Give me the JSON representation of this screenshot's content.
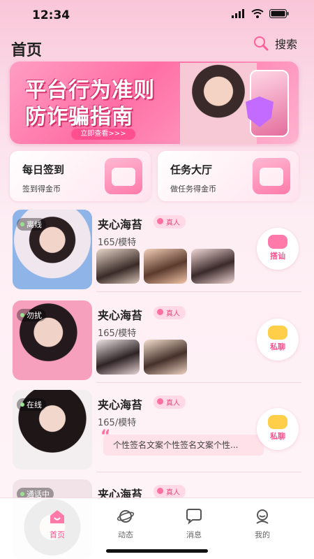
{
  "status": {
    "time": "12:34"
  },
  "header": {
    "title": "首页",
    "search_label": "搜索"
  },
  "banner": {
    "line1": "平台行为准则",
    "line2": "防诈骗指南",
    "cta": "立即查看>>>"
  },
  "cards": [
    {
      "title": "每日签到",
      "sub": "签到得金币",
      "icon": "calendar-check-icon"
    },
    {
      "title": "任务大厅",
      "sub": "做任务得金币",
      "icon": "task-list-icon"
    }
  ],
  "users": [
    {
      "status": "离线",
      "name": "夹心海苔",
      "badge": "真人",
      "meta": "165/模特",
      "action": "搭讪",
      "photos": 3
    },
    {
      "status": "勿扰",
      "name": "夹心海苔",
      "badge": "真人",
      "meta": "165/模特",
      "action": "私聊",
      "photos": 2
    },
    {
      "status": "在线",
      "name": "夹心海苔",
      "badge": "真人",
      "meta": "165/模特",
      "action": "私聊",
      "signature": "个性签名文案个性签名文案个性..."
    },
    {
      "status": "通话中",
      "name": "夹心海苔",
      "badge": "真人"
    }
  ],
  "tabs": [
    {
      "label": "首页",
      "icon": "home-icon",
      "active": true
    },
    {
      "label": "动态",
      "icon": "planet-icon"
    },
    {
      "label": "消息",
      "icon": "message-icon"
    },
    {
      "label": "我的",
      "icon": "profile-icon"
    }
  ],
  "colors": {
    "accent": "#ff4f8f",
    "verify_bg": "#ffd9e6",
    "online": "#9be28f"
  }
}
